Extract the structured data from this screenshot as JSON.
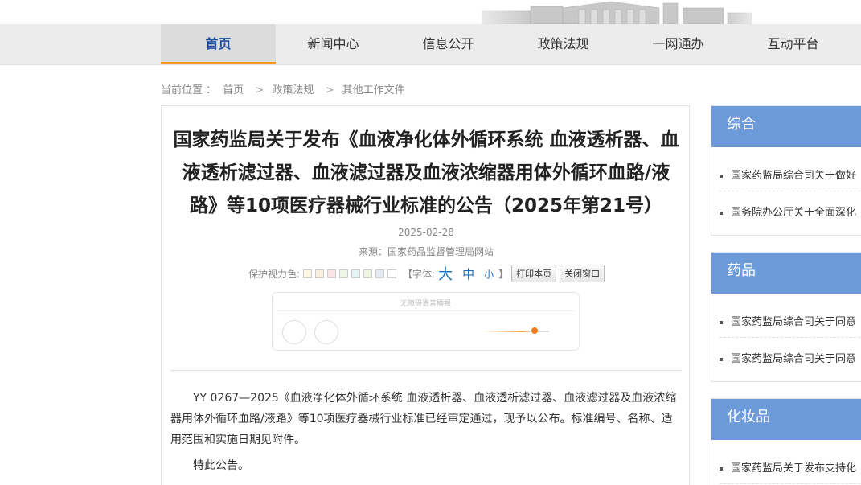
{
  "nav": {
    "items": [
      "首页",
      "新闻中心",
      "信息公开",
      "政策法规",
      "一网通办",
      "互动平台"
    ],
    "active": "首页"
  },
  "breadcrumb": {
    "label": "当前位置",
    "colon": "：",
    "items": [
      "首页",
      "政策法规",
      "其他工作文件"
    ]
  },
  "article": {
    "title": "国家药监局关于发布《血液净化体外循环系统 血液透析器、血液透析滤过器、血液滤过器及血液浓缩器用体外循环血路/液路》等10项医疗器械行业标准的公告（2025年第21号）",
    "date": "2025-02-28",
    "source": "来源：国家药品监督管理局网站",
    "tools": {
      "color_label": "保护视力色:",
      "swatch_colors": [
        "#fbf7e4",
        "#fbeee0",
        "#f9e3e3",
        "#eef7e6",
        "#e4f3f6",
        "#eef5e0",
        "#e6e9f3",
        "#ffffff"
      ],
      "font_label": "【字体:",
      "font_big": "大",
      "font_mid": "中",
      "font_small": "小",
      "font_close": "】",
      "print": "打印本页",
      "close": "关闭窗口"
    },
    "player_label": "无障碍语音播报",
    "paragraph1": "YY 0267—2025《血液净化体外循环系统 血液透析器、血液透析滤过器、血液滤过器及血液浓缩器用体外循环血路/液路》等10项医疗器械行业标准已经审定通过，现予以公布。标准编号、名称、适用范围和实施日期见附件。",
    "paragraph2": "特此公告。"
  },
  "sidebar": [
    {
      "heading": "综合",
      "items": [
        "国家药监局综合司关于做好",
        "国务院办公厅关于全面深化"
      ]
    },
    {
      "heading": "药品",
      "items": [
        "国家药监局综合司关于同意",
        "国家药监局综合司关于同意"
      ]
    },
    {
      "heading": "化妆品",
      "items": [
        "国家药监局关于发布支持化"
      ]
    }
  ],
  "colors": {
    "accent_blue": "#1d4e9e",
    "nav_underline": "#f29a1b",
    "sidebar_head": "#6d9ad9"
  }
}
